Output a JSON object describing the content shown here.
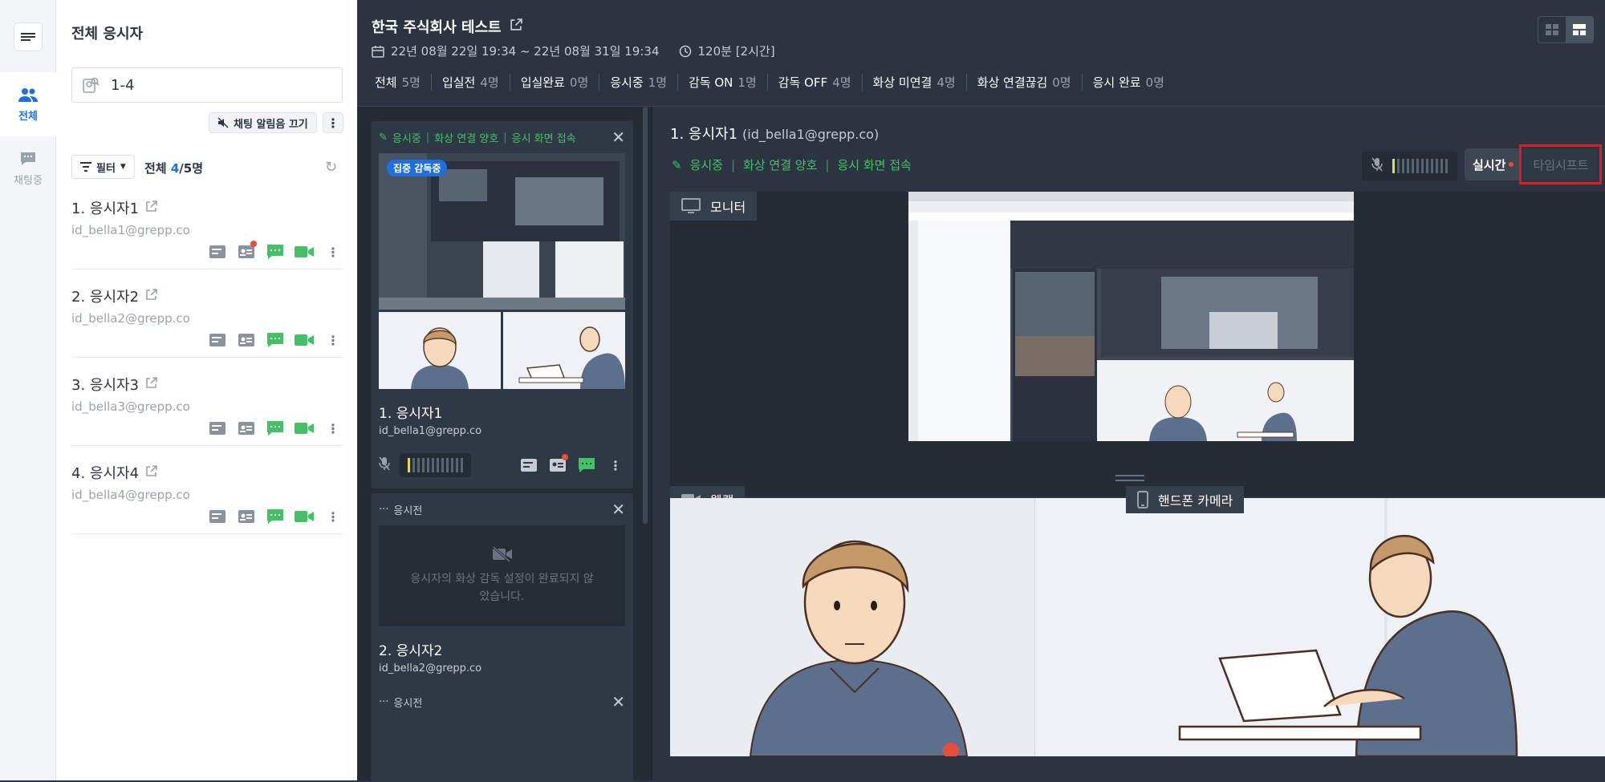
{
  "sidebar": {
    "nav_all": "전체",
    "nav_chat": "채팅중",
    "title": "전체 응시자",
    "search_value": "1-4",
    "mute_label": "채팅 알림음 끄기",
    "filter_label": "필터",
    "total_prefix": "전체",
    "total_count": "4",
    "total_suffix": "/5명",
    "items": [
      {
        "name": "1. 응시자1",
        "email": "id_bella1@grepp.co"
      },
      {
        "name": "2. 응시자2",
        "email": "id_bella2@grepp.co"
      },
      {
        "name": "3. 응시자3",
        "email": "id_bella3@grepp.co"
      },
      {
        "name": "4. 응시자4",
        "email": "id_bella4@grepp.co"
      }
    ]
  },
  "header": {
    "title": "한국 주식회사 테스트",
    "period": "22년 08월 22일 19:34 ~ 22년 08월 31일 19:34",
    "duration": "120분 [2시간]",
    "stats": [
      {
        "label": "전체",
        "value": "5명"
      },
      {
        "label": "입실전",
        "value": "4명"
      },
      {
        "label": "입실완료",
        "value": "0명"
      },
      {
        "label": "응시중",
        "value": "1명"
      },
      {
        "label": "감독 ON",
        "value": "1명"
      },
      {
        "label": "감독 OFF",
        "value": "4명"
      },
      {
        "label": "화상 미연결",
        "value": "4명"
      },
      {
        "label": "화상 연결끊김",
        "value": "0명"
      },
      {
        "label": "응시 완료",
        "value": "0명"
      }
    ]
  },
  "cards": [
    {
      "s1": "응시중",
      "s2": "화상 연결 양호",
      "s3": "응시 화면 접속",
      "badge": "집중 감독중",
      "name": "1. 응시자1",
      "email": "id_bella1@grepp.co"
    },
    {
      "status": "응시전",
      "placeholder": "응시자의 화상 감독 설정이 완료되지 않았습니다.",
      "name": "2. 응시자2",
      "email": "id_bella2@grepp.co"
    },
    {
      "status": "응시전"
    }
  ],
  "detail": {
    "name": "1. 응시자1",
    "email": "(id_bella1@grepp.co)",
    "s1": "응시중",
    "s2": "화상 연결 양호",
    "s3": "응시 화면 접속",
    "live_label": "실시간",
    "timeshift_label": "타임시프트",
    "monitor_label": "모니터",
    "webcam_label": "웹캠",
    "phone_label": "핸드폰 카메라"
  },
  "colors": {
    "accent": "#1f6fe0",
    "success": "#44c066",
    "alert": "#e84c3d",
    "highlight": "#e01b1b"
  }
}
